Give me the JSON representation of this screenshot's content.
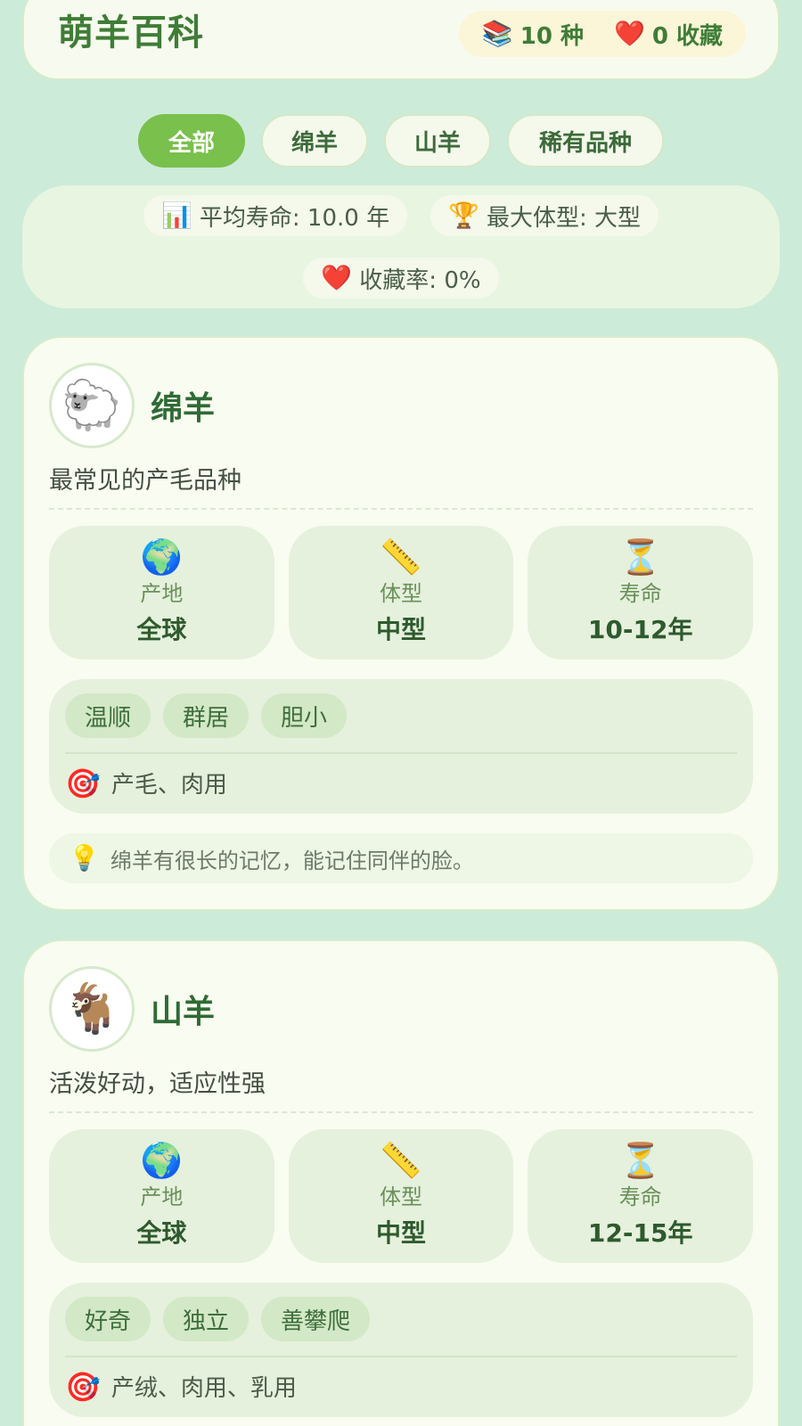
{
  "header": {
    "title": "萌羊百科",
    "count_icon": "📚",
    "count_text": "10 种",
    "fav_icon": "❤️",
    "fav_text": "0 收藏"
  },
  "tabs": [
    {
      "label": "全部",
      "active": true
    },
    {
      "label": "绵羊",
      "active": false
    },
    {
      "label": "山羊",
      "active": false
    },
    {
      "label": "稀有品种",
      "active": false
    }
  ],
  "stats": {
    "avg_life_icon": "📊",
    "avg_life_text": "平均寿命: 10.0 年",
    "max_size_icon": "🏆",
    "max_size_text": "最大体型: 大型",
    "fav_rate_icon": "❤️",
    "fav_rate_text": "收藏率: 0%"
  },
  "breeds": [
    {
      "avatar_icon": "🐑",
      "name": "绵羊",
      "desc": "最常见的产毛品种",
      "origin_icon": "🌍",
      "origin_label": "产地",
      "origin_value": "全球",
      "size_icon": "📏",
      "size_label": "体型",
      "size_value": "中型",
      "life_icon": "⏳",
      "life_label": "寿命",
      "life_value": "10-12年",
      "traits": [
        "温顺",
        "群居",
        "胆小"
      ],
      "purpose_icon": "🎯",
      "purpose": "产毛、肉用",
      "fact_icon": "💡",
      "fact": "绵羊有很长的记忆，能记住同伴的脸。"
    },
    {
      "avatar_icon": "🐐",
      "name": "山羊",
      "desc": "活泼好动，适应性强",
      "origin_icon": "🌍",
      "origin_label": "产地",
      "origin_value": "全球",
      "size_icon": "📏",
      "size_label": "体型",
      "size_value": "中型",
      "life_icon": "⏳",
      "life_label": "寿命",
      "life_value": "12-15年",
      "traits": [
        "好奇",
        "独立",
        "善攀爬"
      ],
      "purpose_icon": "🎯",
      "purpose": "产绒、肉用、乳用"
    }
  ]
}
